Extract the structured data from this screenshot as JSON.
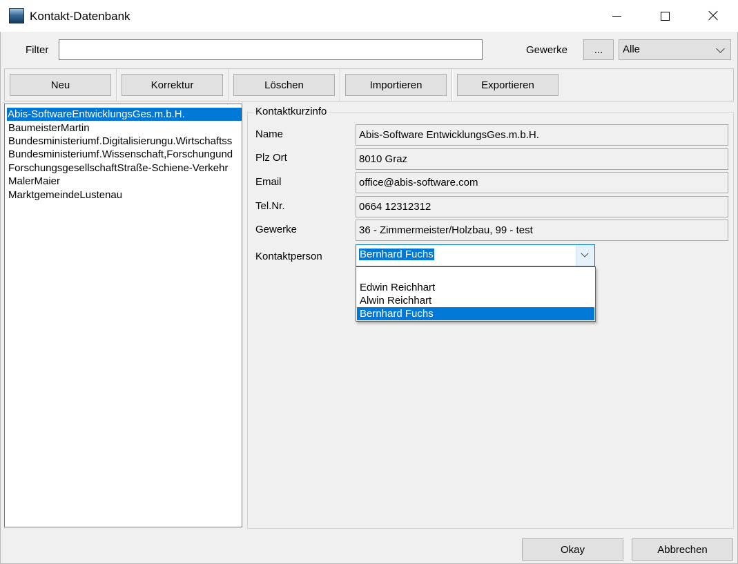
{
  "window": {
    "title": "Kontakt-Datenbank"
  },
  "filter": {
    "label": "Filter",
    "value": "",
    "placeholder": ""
  },
  "gewerke": {
    "label": "Gewerke",
    "browse_label": "...",
    "selected": "Alle"
  },
  "toolbar": {
    "new_label": "Neu",
    "edit_label": "Korrektur",
    "delete_label": "Löschen",
    "import_label": "Importieren",
    "export_label": "Exportieren"
  },
  "contacts": [
    "Abis-SoftwareEntwicklungsGes.m.b.H.",
    "BaumeisterMartin",
    "Bundesministeriumf.Digitalisierungu.Wirtschaftss",
    "Bundesministeriumf.Wissenschaft,Forschungund",
    "ForschungsgesellschaftStraße-Schiene-Verkehr",
    "MalerMaier",
    "MarktgemeindeLustenau"
  ],
  "selected_contact_index": 0,
  "info": {
    "title": "Kontaktkurzinfo",
    "name_label": "Name",
    "name_value": "Abis-Software EntwicklungsGes.m.b.H.",
    "plz_label": "Plz Ort",
    "plz_value": "8010 Graz",
    "email_label": "Email",
    "email_value": "office@abis-software.com",
    "tel_label": "Tel.Nr.",
    "tel_value": "0664 12312312",
    "gewerke_label": "Gewerke",
    "gewerke_value": "36 - Zimmermeister/Holzbau, 99 - test",
    "contact_person_label": "Kontaktperson",
    "contact_person_selected": "Bernhard Fuchs",
    "contact_person_options": [
      "",
      "Edwin Reichhart",
      "Alwin Reichhart",
      "Bernhard Fuchs"
    ]
  },
  "footer": {
    "ok_label": "Okay",
    "cancel_label": "Abbrechen"
  },
  "colors": {
    "selection": "#0078d7",
    "background": "#f0f0f0"
  },
  "icons": {
    "app": "app-window-icon",
    "minimize": "minimize-icon",
    "maximize": "maximize-icon",
    "close": "close-icon",
    "dropdown": "chevron-down-icon"
  }
}
